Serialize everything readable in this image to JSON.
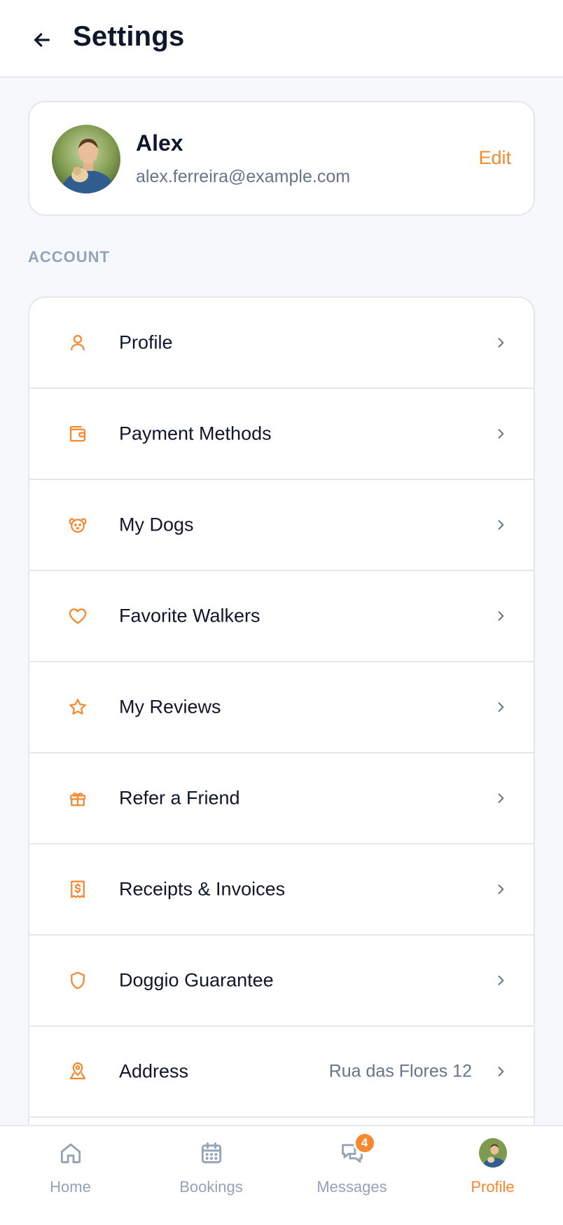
{
  "header": {
    "title": "Settings",
    "back_icon": "arrow-left-icon"
  },
  "profile": {
    "name": "Alex",
    "email": "alex.ferreira@example.com",
    "edit_label": "Edit"
  },
  "account_section": {
    "label": "ACCOUNT",
    "items": [
      {
        "label": "Profile",
        "icon": "user-icon",
        "value": ""
      },
      {
        "label": "Payment Methods",
        "icon": "wallet-icon",
        "value": ""
      },
      {
        "label": "My Dogs",
        "icon": "dog-icon",
        "value": ""
      },
      {
        "label": "Favorite Walkers",
        "icon": "heart-icon",
        "value": ""
      },
      {
        "label": "My Reviews",
        "icon": "star-icon",
        "value": ""
      },
      {
        "label": "Refer a Friend",
        "icon": "gift-icon",
        "value": ""
      },
      {
        "label": "Receipts & Invoices",
        "icon": "receipt-icon",
        "value": ""
      },
      {
        "label": "Doggio Guarantee",
        "icon": "shield-icon",
        "value": ""
      },
      {
        "label": "Address",
        "icon": "map-pin-icon",
        "value": "Rua das Flores 12"
      }
    ]
  },
  "bottom_nav": {
    "items": [
      {
        "label": "Home",
        "icon": "home-icon"
      },
      {
        "label": "Bookings",
        "icon": "calendar-icon"
      },
      {
        "label": "Messages",
        "icon": "chat-icon",
        "badge": "4"
      },
      {
        "label": "Profile",
        "icon": "avatar",
        "active": true
      }
    ]
  },
  "colors": {
    "accent": "#f7882f",
    "text": "#0f172a",
    "muted": "#64748b",
    "border": "#e3e8ef"
  }
}
